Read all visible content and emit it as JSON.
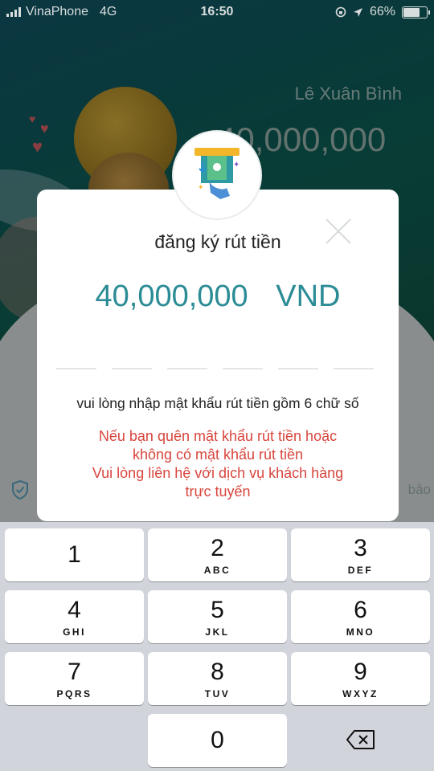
{
  "status_bar": {
    "carrier": "VinaPhone",
    "network": "4G",
    "time": "16:50",
    "battery": "66%",
    "battery_level": 0.66
  },
  "background": {
    "user_name": "Lê Xuân Bình",
    "balance": "40,000,000",
    "guarantee_text": "bảo"
  },
  "modal": {
    "title": "đăng ký rút tiền",
    "amount": "40,000,000",
    "currency": "VND",
    "pin_length": 6,
    "instruction": "vui lòng nhập mật khẩu rút tiền gồm 6 chữ số",
    "warning_lines": [
      "Nếu bạn quên mật khẩu rút tiền hoặc",
      "không có mật khẩu rút tiền",
      "Vui lòng liên hệ với dịch vụ khách hàng",
      "trực tuyến"
    ]
  },
  "keypad": [
    {
      "num": "1",
      "letters": ""
    },
    {
      "num": "2",
      "letters": "ABC"
    },
    {
      "num": "3",
      "letters": "DEF"
    },
    {
      "num": "4",
      "letters": "GHI"
    },
    {
      "num": "5",
      "letters": "JKL"
    },
    {
      "num": "6",
      "letters": "MNO"
    },
    {
      "num": "7",
      "letters": "PQRS"
    },
    {
      "num": "8",
      "letters": "TUV"
    },
    {
      "num": "9",
      "letters": "WXYZ"
    },
    {
      "num": "0",
      "letters": ""
    }
  ],
  "colors": {
    "accent": "#2b8c95",
    "warning": "#d8453d",
    "keyboard_bg": "#d1d4db"
  },
  "icons": [
    "signal-icon",
    "location-icon",
    "lock-rotation-icon",
    "battery-icon",
    "withdraw-atm-icon",
    "close-icon",
    "shield-check-icon",
    "backspace-icon"
  ]
}
